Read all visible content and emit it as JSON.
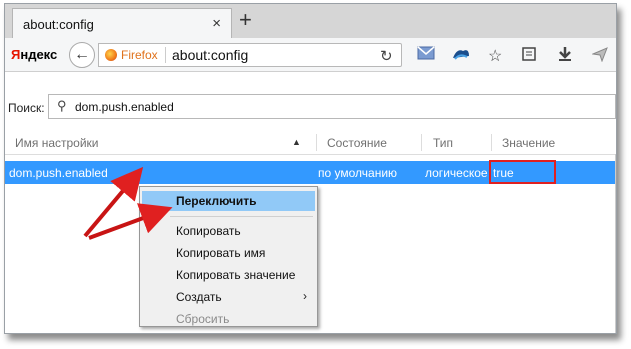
{
  "tab": {
    "title": "about:config",
    "close": "×",
    "new_tab": "+"
  },
  "navbar": {
    "yandex_first": "Я",
    "yandex_rest": "ндекс",
    "identity_label": "Firefox",
    "url": "about:config"
  },
  "search": {
    "label": "Поиск:",
    "value": "dom.push.enabled"
  },
  "columns": {
    "name": "Имя настройки",
    "status": "Состояние",
    "type": "Тип",
    "value": "Значение"
  },
  "row": {
    "name": "dom.push.enabled",
    "status": "по умолчанию",
    "type": "логическое",
    "value": "true"
  },
  "menu": {
    "items": [
      {
        "label": "Переключить"
      },
      {
        "label": "Копировать"
      },
      {
        "label": "Копировать имя"
      },
      {
        "label": "Копировать значение"
      },
      {
        "label": "Создать"
      },
      {
        "label": "Сбросить"
      }
    ]
  },
  "colors": {
    "selection": "#3399ff",
    "menu_highlight": "#91c9f7",
    "annotation": "#e02020"
  }
}
